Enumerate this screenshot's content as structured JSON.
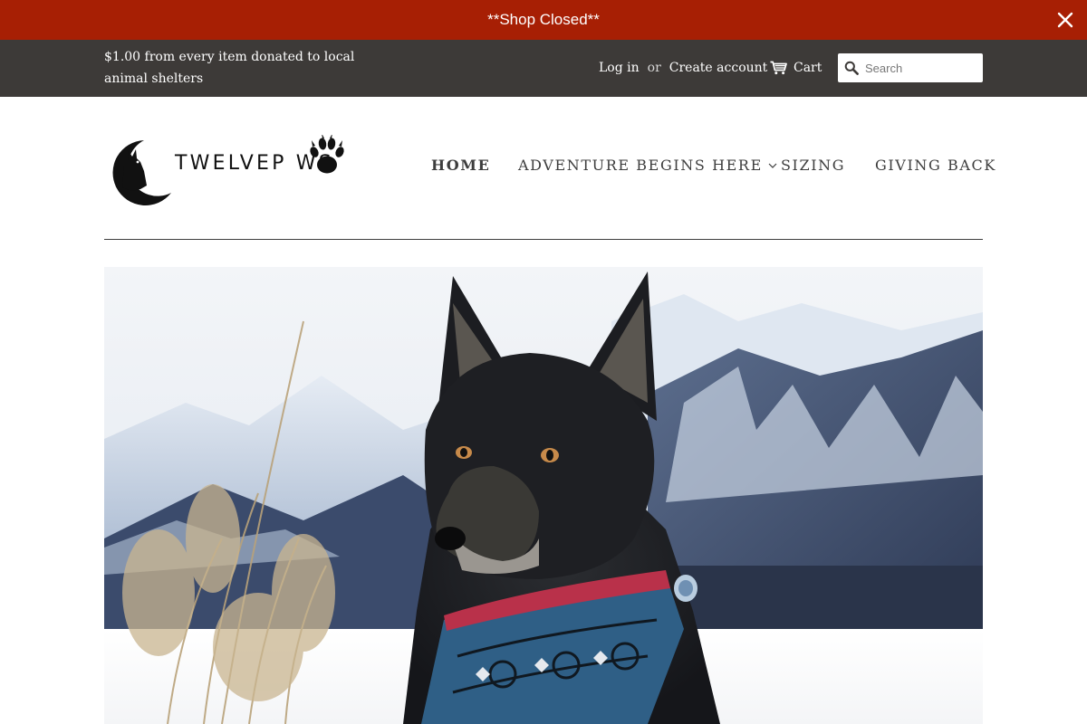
{
  "announcement": {
    "text": "**Shop Closed**",
    "background": "#a71f04"
  },
  "topbar": {
    "promo": "$1.00 from every item donated to local animal shelters",
    "login": "Log in",
    "or": "or",
    "create_account": "Create account",
    "cart": "Cart",
    "search_placeholder": "Search",
    "background": "#3d3a38"
  },
  "logo": {
    "text": "TWELVEP   WS",
    "icons": [
      "wolf-moon-icon",
      "paw-icon"
    ]
  },
  "nav": {
    "items": [
      {
        "label": "HOME",
        "active": true
      },
      {
        "label": "ADVENTURE BEGINS HERE",
        "has_dropdown": true
      },
      {
        "label": "SIZING"
      },
      {
        "label": "GIVING BACK"
      }
    ]
  },
  "icons": {
    "close": "close-icon",
    "cart": "cart-icon",
    "search": "search-icon",
    "dropdown": "chevron-down-icon"
  },
  "hero": {
    "image": "dog-wearing-patterned-bandana-in-snowy-mountains"
  }
}
